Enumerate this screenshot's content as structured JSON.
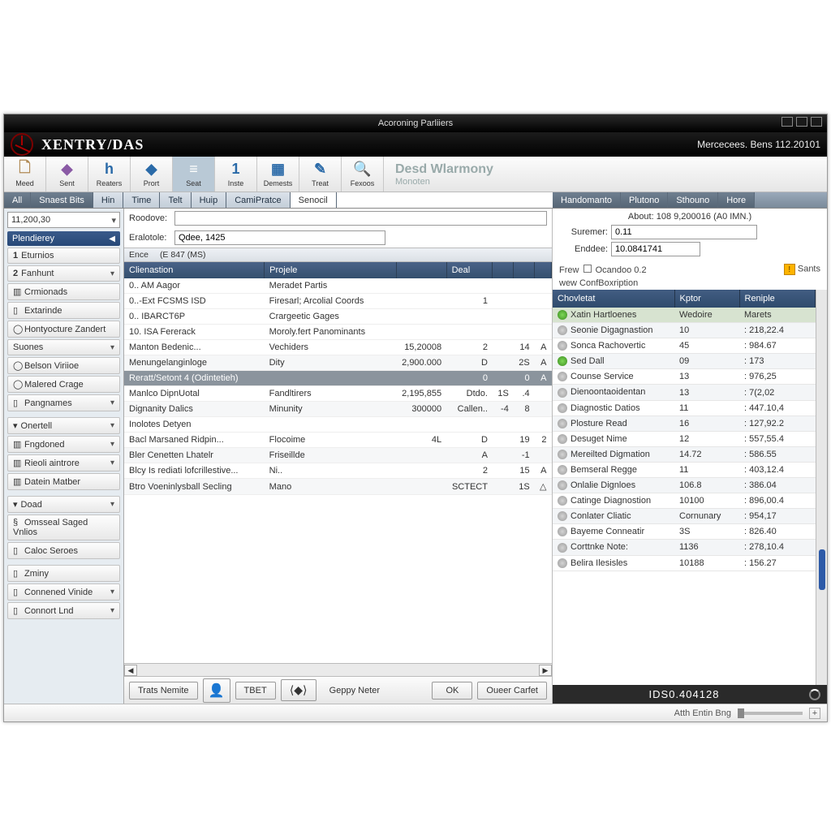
{
  "titlebar": {
    "center": "Acoroning Parliiers"
  },
  "brand": {
    "appname": "XENTRY/DAS",
    "right": "Mercecees. Bens 112.20101"
  },
  "toolbar": [
    {
      "id": "meed",
      "label": "Meed",
      "glyph": "🗋",
      "color": "#b08a55"
    },
    {
      "id": "sent",
      "label": "Sent",
      "glyph": "◆",
      "color": "#8a5aa5"
    },
    {
      "id": "reaters",
      "label": "Reaters",
      "glyph": "h",
      "color": "#2a6aa8"
    },
    {
      "id": "prort",
      "label": "Prort",
      "glyph": "◆",
      "color": "#2a6aa8"
    },
    {
      "id": "seat",
      "label": "Seat",
      "glyph": "≡",
      "color": "#fff",
      "active": true
    },
    {
      "id": "inste",
      "label": "Inste",
      "glyph": "1",
      "color": "#2a6aa8"
    },
    {
      "id": "demests",
      "label": "Demests",
      "glyph": "▦",
      "color": "#2a6aa8"
    },
    {
      "id": "treat",
      "label": "Treat",
      "glyph": "✎",
      "color": "#2a6aa8"
    },
    {
      "id": "fexoos",
      "label": "Fexoos",
      "glyph": "🔍",
      "color": "#2a6aa8"
    }
  ],
  "toolbar_rest": {
    "line1": "Desd Wlarmony",
    "line2": "Monoten"
  },
  "tabs_left": [
    {
      "label": "All",
      "cls": ""
    },
    {
      "label": "Snaest Bits",
      "cls": ""
    },
    {
      "label": "Hin",
      "cls": "light"
    },
    {
      "label": "Time",
      "cls": "light"
    },
    {
      "label": "Telt",
      "cls": "light"
    },
    {
      "label": "Huip",
      "cls": "light"
    },
    {
      "label": "CamiPratce",
      "cls": "light"
    },
    {
      "label": "Senocil",
      "cls": "active"
    }
  ],
  "tabs_right": [
    {
      "label": "Handomanto"
    },
    {
      "label": "Plutono"
    },
    {
      "label": "Sthouno"
    },
    {
      "label": "Hore"
    }
  ],
  "sidebar": {
    "combo": "11,200,30",
    "header": "Plendierey",
    "groups": [
      [
        {
          "label": "Eturnios",
          "pre": "1"
        },
        {
          "label": "Fanhunt",
          "pre": "2",
          "chev": true
        },
        {
          "label": "Crmionads",
          "ico": "▥"
        },
        {
          "label": "Extarinde",
          "ico": "▯"
        },
        {
          "label": "Hontyocture Zandert",
          "ico": "◯"
        },
        {
          "label": "Suones",
          "chev": true
        },
        {
          "label": "Belson Viriioe",
          "ico": "◯"
        },
        {
          "label": "Malered Crage",
          "ico": "◯"
        },
        {
          "label": "Pangnames",
          "ico": "▯",
          "chev": true
        }
      ],
      [
        {
          "label": "Onertell",
          "chev": true,
          "lchev": true
        },
        {
          "label": "Fngdoned",
          "ico": "▥",
          "chev": true
        },
        {
          "label": "Rieoli aintrore",
          "ico": "▥",
          "chev": true
        },
        {
          "label": "Datein Matber",
          "ico": "▥"
        }
      ],
      [
        {
          "label": "Doad",
          "chev": true,
          "lchev": true
        },
        {
          "label": "Omsseal Saged Vnlios",
          "ico": "§"
        },
        {
          "label": "Caloc Seroes",
          "ico": "▯"
        }
      ],
      [
        {
          "label": "Zminy",
          "ico": "▯"
        },
        {
          "label": "Connened Vinide",
          "ico": "▯",
          "chev": true
        },
        {
          "label": "Connort Lnd",
          "ico": "▯",
          "chev": true
        }
      ]
    ]
  },
  "center": {
    "row1_label": "Roodove:",
    "row1_value": "",
    "row2_label": "Eralotole:",
    "row2_value": "Qdee, 1425",
    "band_left": "Ence",
    "band_right": "(E 847 (MS)",
    "columns": [
      "Clienastion",
      "Projele",
      "",
      "Deal",
      "",
      "",
      ""
    ],
    "rows": [
      {
        "c": [
          "0.. AM Aagor",
          "Meradet Partis",
          "",
          "",
          "",
          "",
          ""
        ]
      },
      {
        "c": [
          "0..-Ext FCSMS ISD",
          "Firesarl; Arcolial Coords",
          "",
          "1",
          "",
          "",
          ""
        ]
      },
      {
        "c": [
          "0.. IBARCT6P",
          "Crargeetic Gages",
          "",
          "",
          "",
          "",
          ""
        ]
      },
      {
        "c": [
          "10. ISA Fererack",
          "Moroly.fert Panominants",
          "",
          "",
          "",
          "",
          ""
        ]
      },
      {
        "c": [
          "Manton Bedenic...",
          "Vechiders",
          "15,20008",
          "2",
          "",
          "14",
          "A"
        ]
      },
      {
        "c": [
          "Menungelanginloge",
          "Dity",
          "2,900.000",
          "D",
          "",
          "2S",
          "A"
        ],
        "alt": true
      },
      {
        "c": [
          "Reratt/Setont 4 (Odintetieh)",
          "",
          "",
          "0",
          "",
          "0",
          "A"
        ],
        "sel": true
      },
      {
        "c": [
          "Manlco DipnUotal",
          "Fandltirers",
          "2,195,855",
          "Dtdo.",
          "1S",
          ".4",
          ""
        ]
      },
      {
        "c": [
          "Dignanity Dalics",
          "Minunity",
          "300000",
          "Callen..",
          "-4",
          "8",
          ""
        ],
        "alt": true
      },
      {
        "c": [
          "Inolotes Detyen",
          "",
          "",
          "",
          "",
          "",
          ""
        ]
      },
      {
        "c": [
          "Bacl Marsaned Ridpin...",
          "Flocoime",
          "4L",
          "D",
          "",
          "19",
          "2"
        ]
      },
      {
        "c": [
          "Bler Cenetten Lhatelr",
          "Friseillde",
          "",
          "A",
          "",
          "-1",
          ""
        ],
        "alt": true
      },
      {
        "c": [
          "Blcy Is rediati lofcrillestive...",
          "Ni..",
          "",
          "2",
          "",
          "15",
          "A"
        ]
      },
      {
        "c": [
          "Btro Voeninlysball Secling",
          "Mano",
          "",
          "SCTECT",
          "",
          "1S",
          "△"
        ],
        "alt": true
      }
    ],
    "btnbar": {
      "trans": "Trats Nemite",
      "tbet": "TBET",
      "geppy": "Geppy Neter",
      "ok": "OK",
      "clear": "Oueer Carfet"
    }
  },
  "right": {
    "about": "About: 108 9,200016 (A0 IMN.)",
    "surname_label": "Suremer:",
    "surname_value": "0.11",
    "enddee_label": "Enddee:",
    "enddee_value": "10.0841741",
    "line1_left": "Frew",
    "line1_mid": "Ocandoo 0.2",
    "line1_right": "Sants",
    "line2": "wew ConfBoxription",
    "columns": [
      "Chovletat",
      "Kptor",
      "Reniple"
    ],
    "rows": [
      {
        "dot": "green",
        "c": [
          "Xatin Hartloenes",
          "Wedoire",
          "Marets"
        ],
        "hl": true
      },
      {
        "dot": "gray",
        "c": [
          "Seonie Digagnastion",
          "10",
          ": 218,22.4"
        ]
      },
      {
        "dot": "gray",
        "c": [
          "Sonca Rachovertic",
          "45",
          ": 984.67"
        ]
      },
      {
        "dot": "green",
        "c": [
          "Sed Dall",
          "09",
          ": 173"
        ]
      },
      {
        "dot": "gray",
        "c": [
          "Counse Service",
          "13",
          ": 976,25"
        ]
      },
      {
        "dot": "gray",
        "c": [
          "Dienoontaoidentan",
          "13",
          ": 7(2,02"
        ]
      },
      {
        "dot": "gray",
        "c": [
          "Diagnostic Datios",
          "11",
          ": 447.10,4"
        ]
      },
      {
        "dot": "gray",
        "c": [
          "Plosture Read",
          "16",
          ": 127,92.2"
        ]
      },
      {
        "dot": "gray",
        "c": [
          "Desuget Nime",
          "12",
          ": 557,55.4"
        ]
      },
      {
        "dot": "gray",
        "c": [
          "Mereilted Digmation",
          "14.72",
          ": 586.55"
        ]
      },
      {
        "dot": "gray",
        "c": [
          "Bemseral Regge",
          "11",
          ": 403,12.4"
        ]
      },
      {
        "dot": "gray",
        "c": [
          "Onlalie Dignloes",
          "106.8",
          ": 386.04"
        ]
      },
      {
        "dot": "gray",
        "c": [
          "Catinge Diagnostion",
          "10100",
          ": 896,00.4"
        ]
      },
      {
        "dot": "gray",
        "c": [
          "Conlater Cliatic",
          "Cornunary",
          ": 954,17"
        ]
      },
      {
        "dot": "gray",
        "c": [
          "Bayeme Conneatir",
          "3S",
          ": 826.40"
        ]
      },
      {
        "dot": "gray",
        "c": [
          "Corttnke Note:",
          "1136",
          ": 278,10.4"
        ]
      },
      {
        "dot": "gray",
        "c": [
          "Belira Ilesisles",
          "10188",
          ": 156.27"
        ]
      }
    ],
    "footer": "IDS0.404128"
  },
  "statusbar": {
    "text": "Atth Entin Bng"
  }
}
